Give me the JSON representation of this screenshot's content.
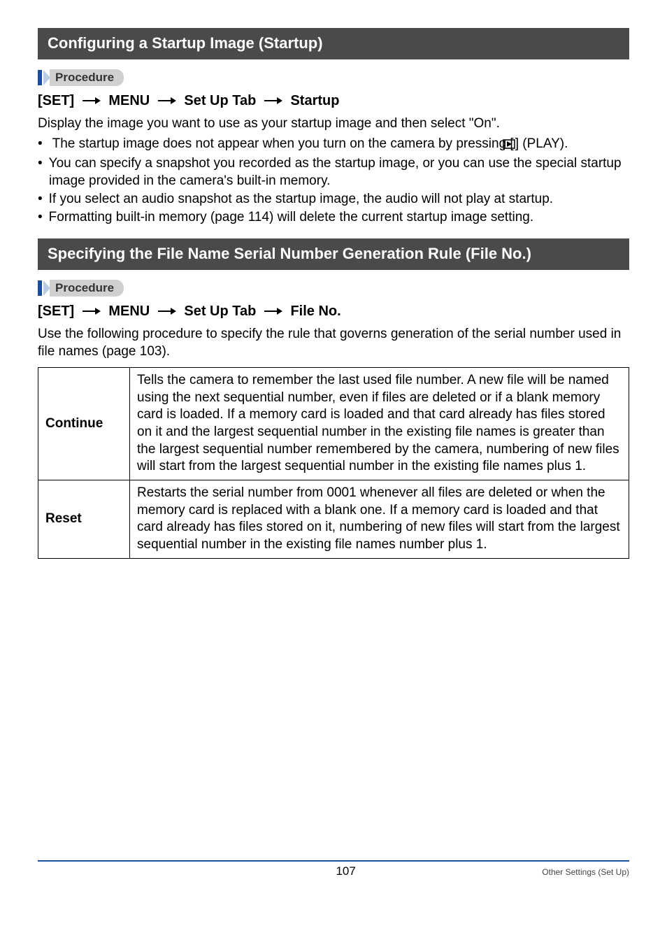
{
  "section1": {
    "header": "Configuring a Startup Image (Startup)",
    "procedure_label": "Procedure",
    "path_parts": [
      "[SET]",
      "MENU",
      "Set Up Tab",
      "Startup"
    ],
    "intro": "Display the image you want to use as your startup image and then select \"On\".",
    "bullets_pre": "The startup image does not appear when you turn on the camera by pressing [",
    "bullets_post": "] (PLAY).",
    "bullet2": "You can specify a snapshot you recorded as the startup image, or you can use the special startup image provided in the camera's built-in memory.",
    "bullet3": "If you select an audio snapshot as the startup image, the audio will not play at startup.",
    "bullet4": "Formatting built-in memory (page 114) will delete the current startup image setting."
  },
  "section2": {
    "header": "Specifying the File Name Serial Number Generation Rule (File No.)",
    "procedure_label": "Procedure",
    "path_parts": [
      "[SET]",
      "MENU",
      "Set Up Tab",
      "File No."
    ],
    "intro": "Use the following procedure to specify the rule that governs generation of the serial number used in file names (page 103).",
    "rows": [
      {
        "label": "Continue",
        "desc": "Tells the camera to remember the last used file number. A new file will be named using the next sequential number, even if files are deleted or if a blank memory card is loaded. If a memory card is loaded and that card already has files stored on it and the largest sequential number in the existing file names is greater than the largest sequential number remembered by the camera, numbering of new files will start from the largest sequential number in the existing file names plus 1."
      },
      {
        "label": "Reset",
        "desc": "Restarts the serial number from 0001 whenever all files are deleted or when the memory card is replaced with a blank one. If a memory card is loaded and that card already has files stored on it, numbering of new files will start from the largest sequential number in the existing file names number plus 1."
      }
    ]
  },
  "footer": {
    "page": "107",
    "section": "Other Settings (Set Up)"
  }
}
